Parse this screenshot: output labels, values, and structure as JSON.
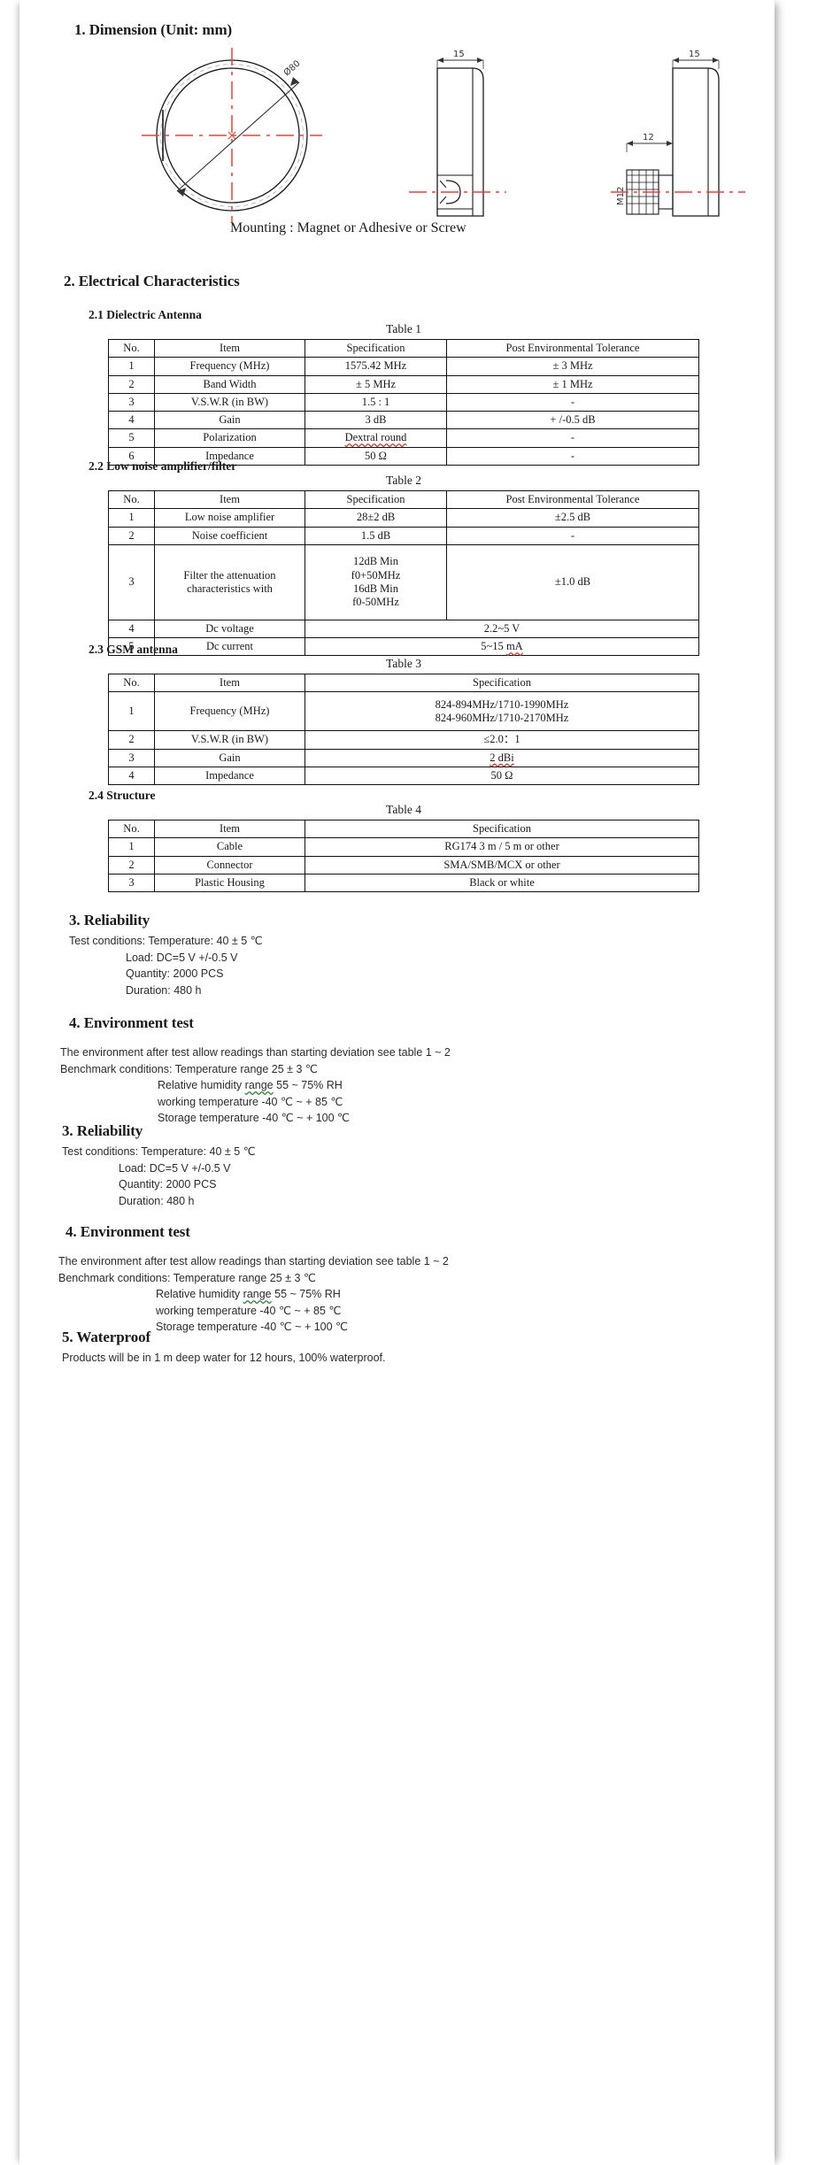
{
  "sections": {
    "dimension": {
      "heading": "1. Dimension (Unit: mm)",
      "mounting_caption": "Mounting : Magnet or Adhesive or Screw",
      "drawing_labels": {
        "diameter": "Ø80",
        "thickness_front": "15",
        "thickness_side": "15",
        "screw_length": "12",
        "thread": "M12"
      }
    },
    "electrical": {
      "heading": "2. Electrical Characteristics",
      "subsections": [
        {
          "label": "2.1 Dielectric Antenna",
          "table_title": "Table 1",
          "columns": [
            "No.",
            "Item",
            "Specification",
            "Post Environmental Tolerance"
          ],
          "rows": [
            [
              "1",
              "Frequency (MHz)",
              "1575.42 MHz",
              "± 3 MHz"
            ],
            [
              "2",
              "Band Width",
              "± 5 MHz",
              "± 1 MHz"
            ],
            [
              "3",
              "V.S.W.R (in BW)",
              "1.5 : 1",
              "-"
            ],
            [
              "4",
              "Gain",
              "3 dB",
              "+ /-0.5 dB"
            ],
            [
              "5",
              "Polarization",
              "Dextral round",
              "-"
            ],
            [
              "6",
              "Impedance",
              "50 Ω",
              "-"
            ]
          ]
        },
        {
          "label": "2.2 Low noise amplifier/filter",
          "table_title": "Table 2",
          "columns": [
            "No.",
            "Item",
            "Specification",
            "Post Environmental Tolerance"
          ],
          "rows": [
            [
              "1",
              "Low noise amplifier",
              "28±2 dB",
              "±2.5 dB"
            ],
            [
              "2",
              "Noise coefficient",
              "1.5 dB",
              "-"
            ],
            [
              "3",
              "Filter the attenuation characteristics with",
              "12dB Min\nf0+50MHz\n16dB Min\nf0-50MHz",
              "±1.0 dB"
            ],
            [
              "4",
              "Dc voltage",
              "2.2~5 V",
              ""
            ],
            [
              "5",
              "Dc current",
              "5~15 mA",
              ""
            ]
          ]
        },
        {
          "label": "2.3 GSM antenna",
          "table_title": "Table 3",
          "columns": [
            "No.",
            "Item",
            "Specification"
          ],
          "rows": [
            [
              "1",
              "Frequency (MHz)",
              "824-894MHz/1710-1990MHz\n824-960MHz/1710-2170MHz"
            ],
            [
              "2",
              "V.S.W.R (in BW)",
              "≤2.0：1"
            ],
            [
              "3",
              "Gain",
              "2 dBi"
            ],
            [
              "4",
              "Impedance",
              "50 Ω"
            ]
          ]
        },
        {
          "label": "2.4 Structure",
          "table_title": "Table 4",
          "columns": [
            "No.",
            "Item",
            "Specification"
          ],
          "rows": [
            [
              "1",
              "Cable",
              "RG174 3 m / 5 m or other"
            ],
            [
              "2",
              "Connector",
              "SMA/SMB/MCX or other"
            ],
            [
              "3",
              "Plastic Housing",
              "Black or white"
            ]
          ]
        }
      ]
    },
    "reliability": {
      "heading": "3. Reliability",
      "lines": [
        "Test conditions: Temperature: 40 ± 5 ℃",
        "Load: DC=5 V +/-0.5 V",
        "Quantity: 2000 PCS",
        "Duration: 480 h"
      ]
    },
    "environment": {
      "heading": "4. Environment test",
      "intro": "The environment after test allow readings than starting deviation see table 1 ~ 2",
      "benchmark_line": "Benchmark conditions: Temperature range   25 ± 3 ℃",
      "lines": [
        "Relative humidity range   55 ~ 75% RH",
        "working temperature   -40 ℃ ~ + 85 ℃",
        "Storage temperature   -40 ℃ ~ + 100 ℃"
      ]
    },
    "waterproof": {
      "heading": "5. Waterproof",
      "text": "Products will be in 1 m deep water for 12 hours, 100% waterproof."
    }
  },
  "colors": {
    "centerline": "#e8403a",
    "outline": "#1a1a1a",
    "spellcheck_red": "#c0392b",
    "spellcheck_green": "#2e7d32"
  }
}
